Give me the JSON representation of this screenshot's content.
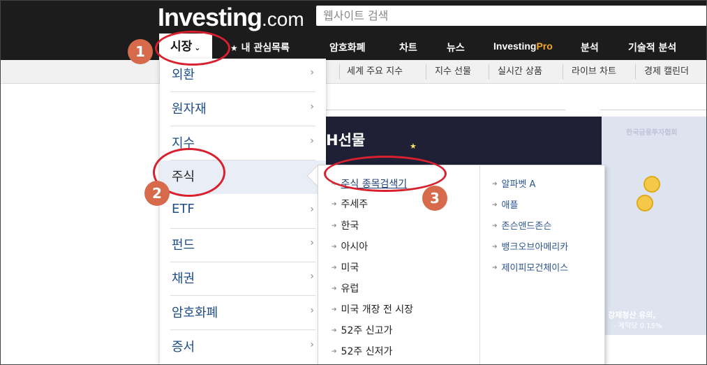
{
  "header": {
    "logo_main": "Investing",
    "logo_suffix": ".com",
    "search_placeholder": "웹사이트 검색",
    "nav": {
      "market": "시장",
      "watchlist": "내 관심목록",
      "crypto": "암호화폐",
      "charts": "차트",
      "news": "뉴스",
      "pro_a": "Investing",
      "pro_b": "Pro",
      "analysis": "분석",
      "technical": "기술적 분석"
    }
  },
  "subnav": {
    "items": [
      "세계 주요 지수",
      "지수 선물",
      "실시간 상품",
      "라이브 차트",
      "경제 캘린더"
    ]
  },
  "markets_menu": {
    "items": [
      {
        "label": "외환",
        "arrow": "›"
      },
      {
        "label": "원자재",
        "arrow": "›"
      },
      {
        "label": "지수",
        "arrow": "›"
      },
      {
        "label": "주식",
        "arrow": "›"
      },
      {
        "label": "ETF",
        "arrow": "›"
      },
      {
        "label": "펀드",
        "arrow": "›"
      },
      {
        "label": "채권",
        "arrow": "›"
      },
      {
        "label": "암호화폐",
        "arrow": "›"
      },
      {
        "label": "증서",
        "arrow": "›"
      }
    ],
    "active": "주식"
  },
  "stocks_submenu": {
    "left": [
      "주식 종목검색기",
      "주세주",
      "한국",
      "아시아",
      "미국",
      "유럽",
      "미국 개장 전 시장",
      "52주 신고가",
      "52주 신저가"
    ],
    "right": [
      "알파벳 A",
      "애플",
      "존슨앤드존슨",
      "뱅크오브아메리카",
      "제이피모건체이스"
    ],
    "highlighted": "주식 종목검색기"
  },
  "banner": {
    "title_fragment": "H선물",
    "corner_text": "한국금융투자협회",
    "note_line1": "강제청산 유의,",
    "note_line2": "- 계약당 0.15%"
  },
  "annotations": {
    "badge1": "1",
    "badge2": "2",
    "badge3": "3",
    "color": "#d8202e"
  },
  "colors": {
    "header_bg": "#1c1c1c",
    "menu_text": "#1d4e89",
    "pro_accent": "#f5a623",
    "badge_bg": "#d66a4a"
  }
}
